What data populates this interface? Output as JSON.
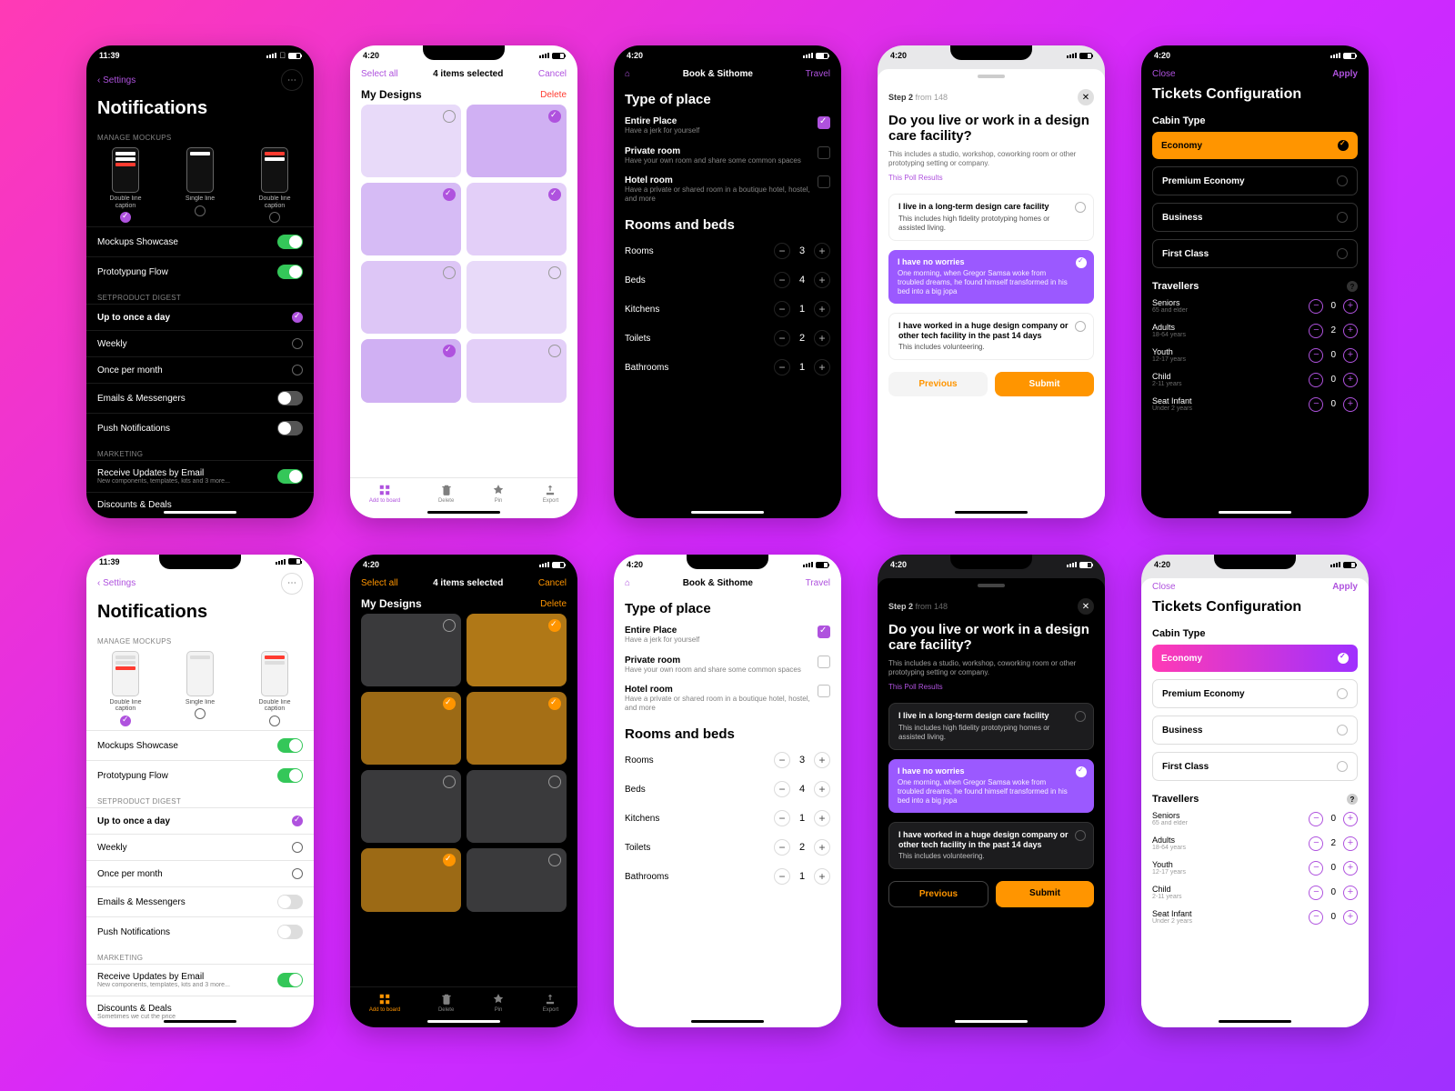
{
  "status": {
    "t1": "11:39",
    "t2": "4:20"
  },
  "notif": {
    "back": "Settings",
    "title": "Notifications",
    "sect1": "MANAGE MOCKUPS",
    "mockups": [
      "Double line caption",
      "Single line",
      "Double line caption"
    ],
    "rows1": [
      "Mockups Showcase",
      "Prototypung Flow"
    ],
    "sect2": "SETPRODUCT DIGEST",
    "rows2": [
      "Up to once a day",
      "Weekly",
      "Once per month",
      "Emails & Messengers",
      "Push Notifications"
    ],
    "sect3": "MARKETING",
    "rows3": [
      {
        "t": "Receive Updates by Email",
        "s": "New components, templates, kits and 3 more..."
      },
      {
        "t": "Discounts & Deals",
        "s": "Sometimes we cut the price"
      }
    ]
  },
  "designs": {
    "selectAll": "Select all",
    "count": "4 items selected",
    "cancel": "Cancel",
    "title": "My Designs",
    "delete": "Delete",
    "tabs": [
      "Add to board",
      "Delete",
      "Pin",
      "Export"
    ]
  },
  "place": {
    "brand": "Book & Sithome",
    "travel": "Travel",
    "h1": "Type of place",
    "opts": [
      {
        "t": "Entire Place",
        "s": "Have a jerk for yourself",
        "on": true
      },
      {
        "t": "Private room",
        "s": "Have your own room and share some common spaces",
        "on": false
      },
      {
        "t": "Hotel room",
        "s": "Have a private or shared room in a boutique hotel, hostel, and more",
        "on": false
      }
    ],
    "h2": "Rooms and beds",
    "steps": [
      {
        "l": "Rooms",
        "v": 3
      },
      {
        "l": "Beds",
        "v": 4
      },
      {
        "l": "Kitchens",
        "v": 1
      },
      {
        "l": "Toilets",
        "v": 2
      },
      {
        "l": "Bathrooms",
        "v": 1
      }
    ]
  },
  "poll": {
    "step": "Step 2",
    "from": "from 148",
    "q": "Do you live or work in a design care facility?",
    "desc": "This includes a studio, workshop, coworking room or other prototyping setting or company.",
    "link": "This Poll Results",
    "cards": [
      {
        "t": "I live in a long-term design care facility",
        "s": "This includes high fidelity prototyping homes or assisted living.",
        "sel": false
      },
      {
        "t": "I have no worries",
        "s": "One morning, when Gregor Samsa woke from troubled dreams, he found himself transformed in his bed into a big jopa",
        "sel": true
      },
      {
        "t": "I have  worked in a huge design company or other tech facility in the past 14 days",
        "s": "This includes volunteering.",
        "sel": false
      }
    ],
    "prev": "Previous",
    "submit": "Submit"
  },
  "tickets": {
    "close": "Close",
    "apply": "Apply",
    "title": "Tickets Configuration",
    "h1": "Cabin Type",
    "cabins": [
      "Economy",
      "Premium Economy",
      "Business",
      "First Class"
    ],
    "h2": "Travellers",
    "trav": [
      {
        "t": "Seniors",
        "s": "65 and elder",
        "v": 0
      },
      {
        "t": "Adults",
        "s": "18-64 years",
        "v": 2
      },
      {
        "t": "Youth",
        "s": "12-17 years",
        "v": 0
      },
      {
        "t": "Child",
        "s": "2-11 years",
        "v": 0
      },
      {
        "t": "Seat Infant",
        "s": "Under 2 years",
        "v": 0
      }
    ]
  }
}
